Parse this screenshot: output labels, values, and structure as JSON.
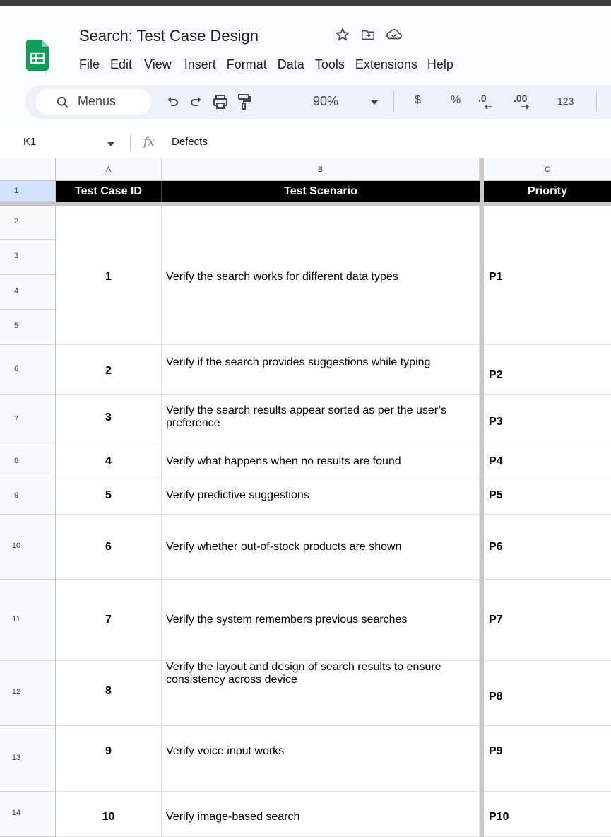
{
  "app": {
    "doc_title": "Search: Test Case Design",
    "logo": "google-sheets-logo",
    "title_icons": [
      "star-icon",
      "move-to-folder-icon",
      "cloud-saved-icon"
    ]
  },
  "menu": [
    "File",
    "Edit",
    "View",
    "Insert",
    "Format",
    "Data",
    "Tools",
    "Extensions",
    "Help"
  ],
  "toolbar": {
    "search_label": "Menus",
    "zoom": "90%",
    "currency": "$",
    "percent": "%",
    "decrease_decimal": ".0",
    "increase_decimal": ".00",
    "number_format": "123"
  },
  "formula_bar": {
    "cell_ref": "K1",
    "fx": "fx",
    "value": "Defects"
  },
  "columns": [
    "A",
    "B",
    "C"
  ],
  "header_row": {
    "row_number": "1",
    "cells": [
      "Test Case ID",
      "Test Scenario",
      "Priority"
    ]
  },
  "row_numbers": [
    "2",
    "3",
    "4",
    "5",
    "6",
    "7",
    "8",
    "9",
    "10",
    "11",
    "12",
    "13",
    "14"
  ],
  "rows": [
    {
      "id": "1",
      "scenario": "Verify the search works for different data types",
      "priority": "P1"
    },
    {
      "id": "2",
      "scenario": "Verify if the search provides suggestions while typing",
      "priority": "P2"
    },
    {
      "id": "3",
      "scenario": "Verify the search results appear sorted as per the user’s preference",
      "priority": "P3"
    },
    {
      "id": "4",
      "scenario": "Verify what happens when no results are found",
      "priority": "P4"
    },
    {
      "id": "5",
      "scenario": "Verify predictive suggestions",
      "priority": "P5"
    },
    {
      "id": "6",
      "scenario": "Verify whether out-of-stock products are shown",
      "priority": "P6"
    },
    {
      "id": "7",
      "scenario": "Verify the system remembers previous searches",
      "priority": "P7"
    },
    {
      "id": "8",
      "scenario": "Verify the layout and design of search results to ensure consistency across device",
      "priority": "P8"
    },
    {
      "id": "9",
      "scenario": "Verify voice input works",
      "priority": "P9"
    },
    {
      "id": "10",
      "scenario": "Verify image-based search",
      "priority": "P10"
    }
  ],
  "colors": {
    "header_bg": "#000000",
    "header_text": "#ffffff",
    "sheets_green": "#0f9d58"
  }
}
